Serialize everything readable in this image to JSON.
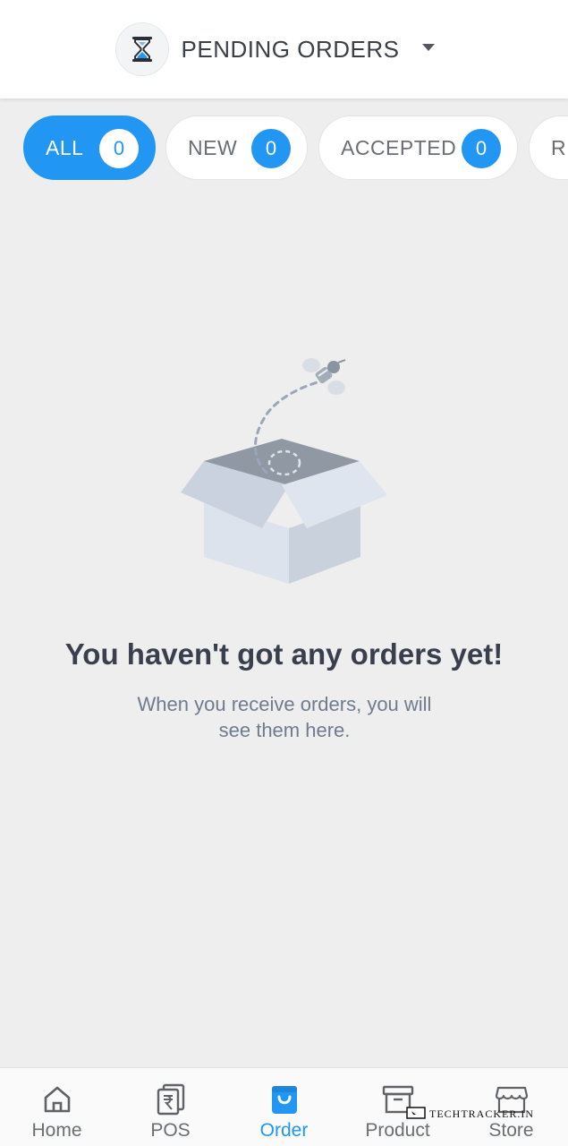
{
  "header": {
    "title": "PENDING ORDERS",
    "icon": "hourglass-icon"
  },
  "tabs": [
    {
      "label": "ALL",
      "count": "0",
      "active": true
    },
    {
      "label": "NEW",
      "count": "0",
      "active": false
    },
    {
      "label": "ACCEPTED",
      "count": "0",
      "active": false
    },
    {
      "label": "RE",
      "count": "",
      "active": false
    }
  ],
  "empty_state": {
    "title": "You haven't got any orders yet!",
    "subtitle_line1": "When you receive orders, you will",
    "subtitle_line2": "see them here."
  },
  "bottom_nav": [
    {
      "label": "Home",
      "icon": "home-icon",
      "active": false
    },
    {
      "label": "POS",
      "icon": "receipt-rupee-icon",
      "active": false
    },
    {
      "label": "Order",
      "icon": "shopping-bag-icon",
      "active": true
    },
    {
      "label": "Product",
      "icon": "archive-box-icon",
      "active": false
    },
    {
      "label": "Store",
      "icon": "storefront-icon",
      "active": false
    }
  ],
  "watermark": "TECHTRACKER.IN",
  "colors": {
    "accent": "#2196f3",
    "background": "#eeeeee",
    "title_text": "#3a3f4d",
    "subtitle_text": "#6f7b8e"
  }
}
